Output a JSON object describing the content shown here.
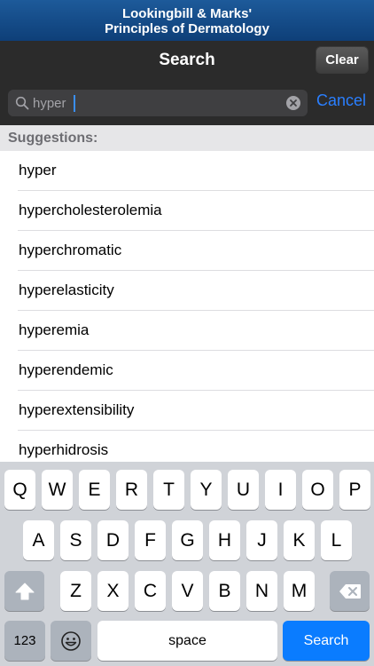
{
  "app": {
    "title_line1": "Lookingbill & Marks'",
    "title_line2": "Principles of Dermatology"
  },
  "nav": {
    "title": "Search",
    "clear_label": "Clear"
  },
  "search": {
    "value": "hyper",
    "cancel_label": "Cancel"
  },
  "suggestions": {
    "header": "Suggestions:",
    "items": [
      "hyper",
      "hypercholesterolemia",
      "hyperchromatic",
      "hyperelasticity",
      "hyperemia",
      "hyperendemic",
      "hyperextensibility",
      "hyperhidrosis"
    ]
  },
  "keyboard": {
    "row1": [
      "Q",
      "W",
      "E",
      "R",
      "T",
      "Y",
      "U",
      "I",
      "O",
      "P"
    ],
    "row2": [
      "A",
      "S",
      "D",
      "F",
      "G",
      "H",
      "J",
      "K",
      "L"
    ],
    "row3": [
      "Z",
      "X",
      "C",
      "V",
      "B",
      "N",
      "M"
    ],
    "numbers_label": "123",
    "space_label": "space",
    "search_label": "Search",
    "shift_icon": "shift-icon",
    "delete_icon": "delete-icon",
    "emoji_icon": "emoji-icon"
  },
  "colors": {
    "title_bar": "#1d5a9a",
    "nav_bar": "#2b2b2b",
    "accent": "#2a7fff",
    "search_key": "#0a7cff"
  }
}
